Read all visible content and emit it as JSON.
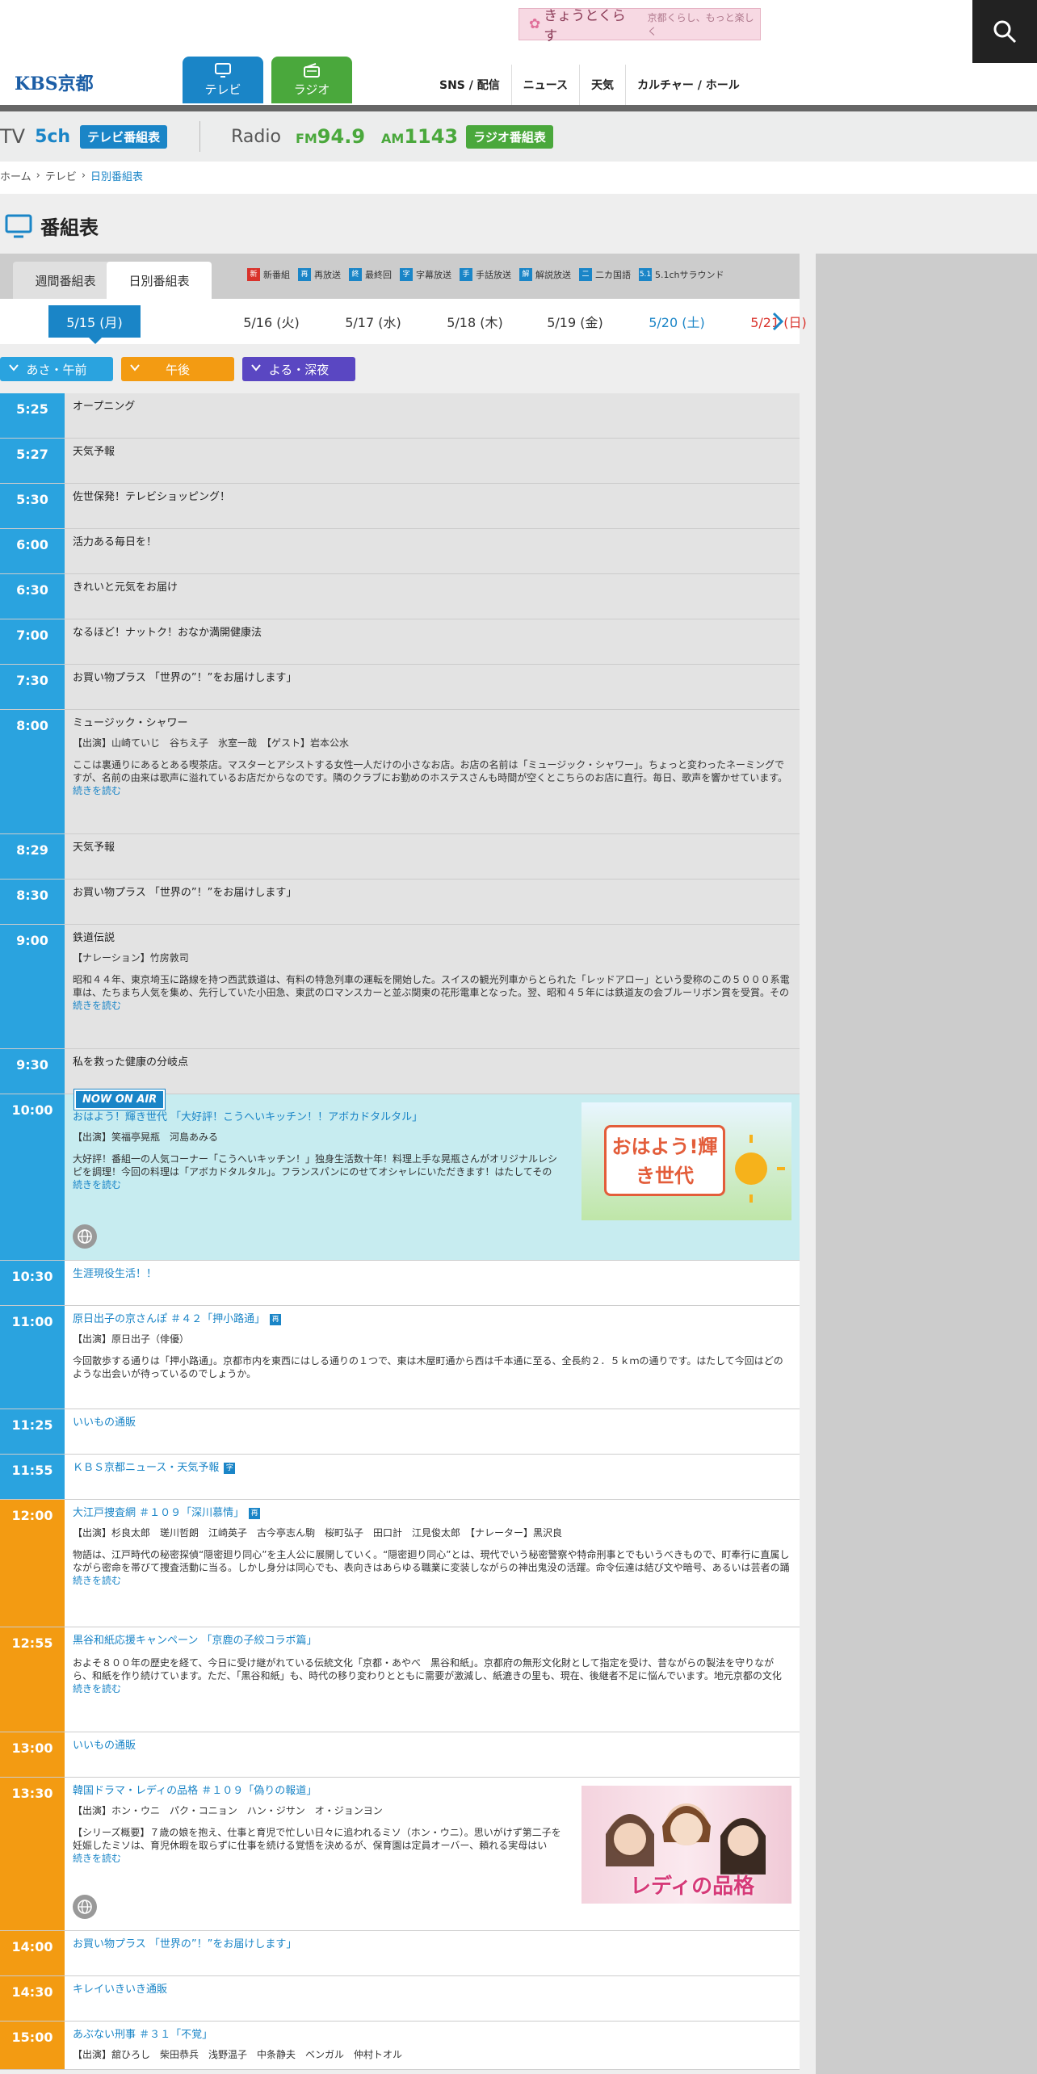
{
  "banner": {
    "text": "きょうとくらす",
    "sub": "京都くらし、もっと楽しく"
  },
  "logo": "KBS京都",
  "nav": {
    "tv": "テレビ",
    "radio": "ラジオ",
    "links": [
      "SNS / 配信",
      "ニュース",
      "天気",
      "カルチャー / ホール"
    ]
  },
  "channel": {
    "tv_label": "TV",
    "tv_ch": "5ch",
    "tv_btn": "テレビ番組表",
    "radio_label": "Radio",
    "fm_prefix": "FM",
    "fm": "94.9",
    "am_prefix": "AM",
    "am": "1143",
    "radio_btn": "ラジオ番組表"
  },
  "breadcrumb": [
    "ホーム",
    "テレビ",
    "日別番組表"
  ],
  "page_title": "番組表",
  "view_tabs": [
    "週間番組表",
    "日別番組表"
  ],
  "legend": [
    {
      "mark": "新",
      "label": "新番組",
      "color": "#d9322b"
    },
    {
      "mark": "再",
      "label": "再放送",
      "color": "#1a85c7"
    },
    {
      "mark": "終",
      "label": "最終回",
      "color": "#1a85c7"
    },
    {
      "mark": "字",
      "label": "字幕放送",
      "color": "#1a85c7"
    },
    {
      "mark": "手",
      "label": "手話放送",
      "color": "#1a85c7"
    },
    {
      "mark": "解",
      "label": "解説放送",
      "color": "#1a85c7"
    },
    {
      "mark": "二",
      "label": "二カ国語",
      "color": "#1a85c7"
    },
    {
      "mark": "5.1",
      "label": "5.1chサラウンド",
      "color": "#1a85c7"
    }
  ],
  "dates": [
    {
      "label": "5/15 (月)",
      "color": "#ffffff"
    },
    {
      "label": "5/16 (火)",
      "color": "#333333"
    },
    {
      "label": "5/17 (水)",
      "color": "#333333"
    },
    {
      "label": "5/18 (木)",
      "color": "#333333"
    },
    {
      "label": "5/19 (金)",
      "color": "#333333"
    },
    {
      "label": "5/20 (土)",
      "color": "#1a85c7"
    },
    {
      "label": "5/21 (日)",
      "color": "#d9322b"
    }
  ],
  "filters": [
    "あさ・午前",
    "午後",
    "よる・深夜"
  ],
  "now_on_air": "NOW ON AIR",
  "more": "続きを読む",
  "thumbs": {
    "ohayo": "おはよう!輝き世代",
    "lady": "レディの品格"
  },
  "programs": [
    {
      "time": "5:25",
      "title": "オープニング",
      "state": "past",
      "period": "am"
    },
    {
      "time": "5:27",
      "title": "天気予報",
      "state": "past",
      "period": "am"
    },
    {
      "time": "5:30",
      "title": "佐世保発！テレビショッピング！",
      "state": "past",
      "period": "am"
    },
    {
      "time": "6:00",
      "title": "活力ある毎日を！",
      "state": "past",
      "period": "am"
    },
    {
      "time": "6:30",
      "title": "きれいと元気をお届け",
      "state": "past",
      "period": "am"
    },
    {
      "time": "7:00",
      "title": "なるほど！ナットク！おなか満開健康法",
      "state": "past",
      "period": "am"
    },
    {
      "time": "7:30",
      "title": "お買い物プラス 「世界の”！”をお届けします」",
      "state": "past",
      "period": "am"
    },
    {
      "time": "8:00",
      "title": "ミュージック・シャワー",
      "cast": "【出演】山崎ていじ　谷ちえ子　氷室一哉　【ゲスト】岩本公水",
      "desc": "ここは裏通りにあるとある喫茶店。マスターとアシストする女性一人だけの小さなお店。お店の名前は「ミュージック・シャワー」。ちょっと変わったネーミングですが、名前の由来は歌声に溢れているお店だからなのです。隣のクラブにお勤めのホステスさんも時間が空くとこちらのお店に直行。毎日、歌声を響かせています。",
      "more": true,
      "state": "past",
      "period": "am"
    },
    {
      "time": "8:29",
      "title": "天気予報",
      "state": "past",
      "period": "am"
    },
    {
      "time": "8:30",
      "title": "お買い物プラス 「世界の”！”をお届けします」",
      "state": "past",
      "period": "am"
    },
    {
      "time": "9:00",
      "title": "鉄道伝説",
      "cast": "【ナレーション】竹房敦司",
      "desc": "昭和４４年、東京埼玉に路線を持つ西武鉄道は、有料の特急列車の運転を開始した。スイスの観光列車からとられた「レッドアロー」という愛称のこの５０００系電車は、たちまち人気を集め、先行していた小田急、東武のロマンスカーと並ぶ関東の花形電車となった。翌、昭和４５年には鉄道友の会ブルーリボン賞を受賞。その",
      "more": true,
      "state": "past",
      "period": "am"
    },
    {
      "time": "9:30",
      "title": "私を救った健康の分岐点",
      "state": "past",
      "period": "am"
    },
    {
      "time": "10:00",
      "title": "おはよう！輝き世代 「大好評！こうへいキッチン！！アボカドタルタル」",
      "cast": "【出演】笑福亭晃瓶　河島あみる",
      "desc": "大好評！番組一の人気コーナー「こうへいキッチン！」独身生活数十年！料理上手な晃瓶さんがオリジナルレシピを調理！今回の料理は「アボカドタルタル」。フランスパンにのせてオシャレにいただきます！はたしてその",
      "more": true,
      "web": true,
      "thumb": "ohayo",
      "state": "now",
      "period": "am"
    },
    {
      "time": "10:30",
      "title": "生涯現役生活！！",
      "state": "fut",
      "period": "am"
    },
    {
      "time": "11:00",
      "title": "原日出子の京さんぽ ＃４２「押小路通」",
      "badge": "再",
      "cast": "【出演】原日出子（俳優）",
      "desc": "今回散歩する通りは「押小路通」。京都市内を東西にはしる通りの１つで、東は木屋町通から西は千本通に至る、全長約２．５ｋｍの通りです。はたして今回はどのような出会いが待っているのでしょうか。",
      "state": "fut",
      "period": "am"
    },
    {
      "time": "11:25",
      "title": "いいもの通販",
      "state": "fut",
      "period": "am"
    },
    {
      "time": "11:55",
      "title": "ＫＢＳ京都ニュース・天気予報",
      "badge": "字",
      "state": "fut",
      "period": "am"
    },
    {
      "time": "12:00",
      "title": "大江戸捜査網 ＃１０９「深川慕情」",
      "badge": "再",
      "cast": "【出演】杉良太郎　瑳川哲朗　江崎英子　古今亭志ん駒　桜町弘子　田口計　江見俊太郎　【ナレーター】黒沢良",
      "desc": "物語は、江戸時代の秘密探偵“隠密廻り同心”を主人公に展開していく。“隠密廻り同心”とは、現代でいう秘密警察や特命刑事とでもいうべきもので、町奉行に直属しながら密命を帯びて捜査活動に当る。しかし身分は同心でも、表向きはあらゆる職業に変装しながらの神出鬼没の活躍。命令伝達は結び文や暗号、あるいは芸者の踊",
      "more": true,
      "state": "fut",
      "period": "pm"
    },
    {
      "time": "12:55",
      "title": "黒谷和紙応援キャンペーン 「京鹿の子絞コラボ篇」",
      "desc": "およそ８００年の歴史を経て、今日に受け継がれている伝統文化「京都・あやべ　黒谷和紙」。京都府の無形文化財として指定を受け、昔ながらの製法を守りながら、和紙を作り続けています。ただ、「黒谷和紙」も、時代の移り変わりとともに需要が激減し、紙漉きの里も、現在、後継者不足に悩んでいます。地元京都の文化",
      "more": true,
      "state": "fut",
      "period": "pm"
    },
    {
      "time": "13:00",
      "title": "いいもの通販",
      "state": "fut",
      "period": "pm"
    },
    {
      "time": "13:30",
      "title": "韓国ドラマ・レディの品格 ＃１０９「偽りの報道」",
      "cast": "【出演】ホン・ウニ　パク・コニョン　ハン・ジサン　オ・ジョンヨン",
      "desc": "【シリーズ概要】７歳の娘を抱え、仕事と育児で忙しい日々に追われるミソ（ホン・ウニ）。思いがけず第二子を妊娠したミソは、育児休暇を取らずに仕事を続ける覚悟を決めるが、保育園は定員オーバー、頼れる実母はい",
      "more": true,
      "web": true,
      "thumb": "lady",
      "state": "fut",
      "period": "pm"
    },
    {
      "time": "14:00",
      "title": "お買い物プラス 「世界の”！”をお届けします」",
      "state": "fut",
      "period": "pm"
    },
    {
      "time": "14:30",
      "title": "キレイいきいき通販",
      "state": "fut",
      "period": "pm"
    },
    {
      "time": "15:00",
      "title": "あぶない刑事 ＃３１「不覚」",
      "cast": "【出演】舘ひろし　柴田恭兵　浅野温子　中条静夫　ベンガル　仲村トオル",
      "state": "fut",
      "period": "pm"
    }
  ]
}
